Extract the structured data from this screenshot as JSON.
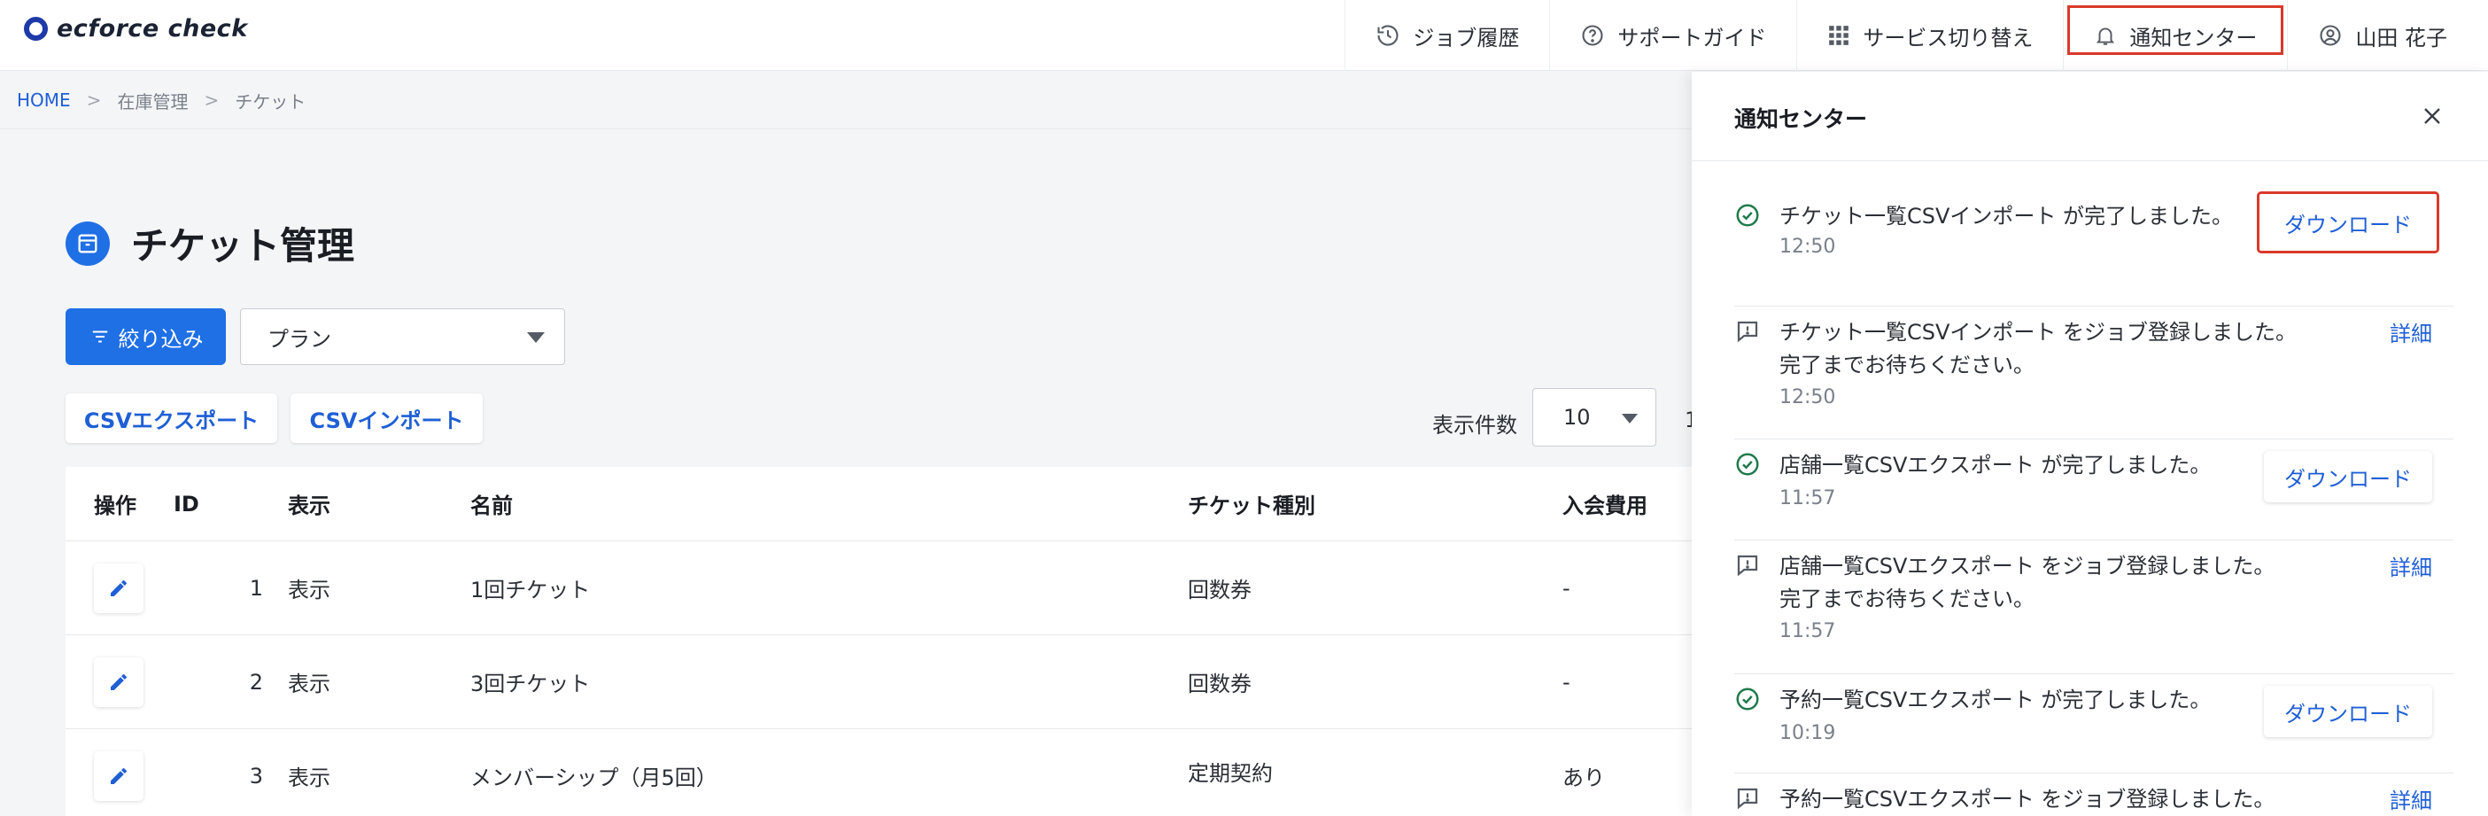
{
  "header": {
    "logo_text": "ecforce check",
    "nav": [
      {
        "label": "ジョブ履歴",
        "icon": "history-icon"
      },
      {
        "label": "サポートガイド",
        "icon": "help-circle-icon"
      },
      {
        "label": "サービス切り替え",
        "icon": "grid-icon"
      },
      {
        "label": "通知センター",
        "icon": "bell-icon"
      },
      {
        "label": "山田 花子",
        "icon": "user-circle-icon"
      }
    ]
  },
  "breadcrumb": {
    "home": "HOME",
    "level1": "在庫管理",
    "current": "チケット",
    "separator": ">"
  },
  "page": {
    "title": "チケット管理",
    "filter_button": "絞り込み",
    "plan_select": "プラン",
    "csv_export": "CSVエクスポート",
    "csv_import": "CSVインポート",
    "pagesize_label": "表示件数",
    "pagesize_value": "10",
    "pager_peek": "1"
  },
  "table": {
    "headers": [
      "操作",
      "ID",
      "表示",
      "名前",
      "チケット種別",
      "入会費用"
    ],
    "rows": [
      {
        "id": "1",
        "display": "表示",
        "name": "1回チケット",
        "type": "回数券",
        "fee": "-"
      },
      {
        "id": "2",
        "display": "表示",
        "name": "3回チケット",
        "type": "回数券",
        "fee": "-"
      },
      {
        "id": "3",
        "display": "表示",
        "name": "メンバーシップ（月5回）",
        "type": "定期契約",
        "fee": "あり"
      }
    ]
  },
  "notification_panel": {
    "title": "通知センター",
    "items": [
      {
        "kind": "done",
        "line1": "チケット一覧CSVインポート が完了しました。",
        "line2": "",
        "time": "12:50",
        "action": "ダウンロード"
      },
      {
        "kind": "queued",
        "line1": "チケット一覧CSVインポート をジョブ登録しました。",
        "line2": "完了までお待ちください。",
        "time": "12:50",
        "action": "詳細"
      },
      {
        "kind": "done",
        "line1": "店舗一覧CSVエクスポート が完了しました。",
        "line2": "",
        "time": "11:57",
        "action": "ダウンロード"
      },
      {
        "kind": "queued",
        "line1": "店舗一覧CSVエクスポート をジョブ登録しました。",
        "line2": "完了までお待ちください。",
        "time": "11:57",
        "action": "詳細"
      },
      {
        "kind": "done",
        "line1": "予約一覧CSVエクスポート が完了しました。",
        "line2": "",
        "time": "10:19",
        "action": "ダウンロード"
      },
      {
        "kind": "queued",
        "line1": "予約一覧CSVエクスポート をジョブ登録しました。",
        "line2": "",
        "time": "",
        "action": "詳細"
      }
    ]
  },
  "colors": {
    "primary": "#1f6fe5",
    "link": "#1f5fd6",
    "highlight_border": "#d93a2b",
    "success_icon": "#1e7a4a"
  }
}
